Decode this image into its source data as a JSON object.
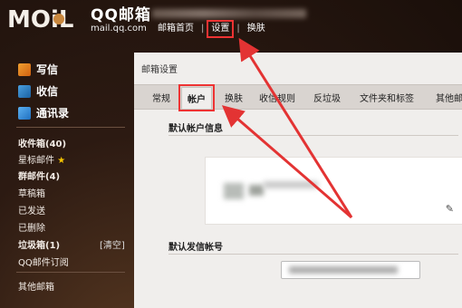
{
  "logo": {
    "brand": "MOiL",
    "name_cn": "QQ邮箱",
    "domain": "mail.qq.com"
  },
  "topnav": {
    "home": "邮箱首页",
    "sep": "|",
    "settings": "设置",
    "skin": "换肤"
  },
  "sidebar": {
    "compose": "写信",
    "inbox": "收信",
    "contacts": "通讯录",
    "folders": {
      "inbox_count": "收件箱(40)",
      "starred": "星标邮件",
      "group": "群邮件(4)",
      "drafts": "草稿箱",
      "sent": "已发送",
      "deleted": "已删除",
      "spam": "垃圾箱(1)",
      "clear": "[清空]",
      "subscriptions": "QQ邮件订阅",
      "other": "其他邮箱"
    }
  },
  "settings": {
    "title": "邮箱设置",
    "tabs": [
      "常规",
      "帐户",
      "换肤",
      "收信规则",
      "反垃圾",
      "文件夹和标签",
      "其他邮"
    ],
    "active_tab": "帐户",
    "default_account_title": "默认帐户信息",
    "default_sender_title": "默认发信帐号"
  },
  "colors": {
    "annotation": "#e33333",
    "star": "#f5c400"
  },
  "icons": {
    "edit": "pencil-icon",
    "compose": "compose-icon",
    "inbox": "download-icon",
    "contacts": "contacts-icon"
  }
}
